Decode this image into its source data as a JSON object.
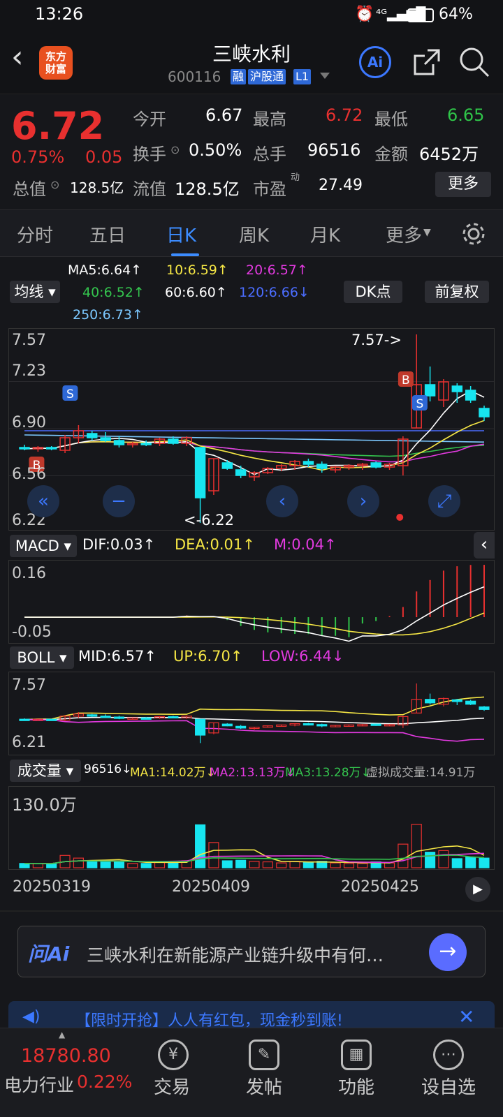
{
  "status": {
    "time": "13:26",
    "battery": "64%"
  },
  "header": {
    "title": "三峡水利",
    "code": "600116",
    "tags": [
      "融",
      "沪股通",
      "L1"
    ],
    "logo": "东方\n财富",
    "ai_label": "Ai"
  },
  "quote": {
    "price": "6.72",
    "change_pct": "0.75%",
    "change": "0.05",
    "open_label": "今开",
    "open": "6.67",
    "high_label": "最高",
    "high": "6.72",
    "low_label": "最低",
    "low": "6.65",
    "turnover_label": "换手",
    "turnover": "0.50%",
    "volume_label": "总手",
    "volume": "96516",
    "amount_label": "金额",
    "amount": "6452万",
    "mktcap_label": "总值",
    "mktcap": "128.5亿",
    "float_label": "流值",
    "float": "128.5亿",
    "pe_label": "市盈",
    "pe_sup": "动",
    "pe": "27.49",
    "more": "更多"
  },
  "tabs": [
    "分时",
    "五日",
    "日K",
    "周K",
    "月K",
    "更多"
  ],
  "ma": {
    "ma5": "MA5:6.64↑",
    "ma10": "10:6.59↑",
    "ma20": "20:6.57↑",
    "ma40": "40:6.52↑",
    "ma60": "60:6.60↑",
    "ma120": "120:6.66↓",
    "ma250": "250:6.73↑",
    "junxian": "均线",
    "dk": "DK点",
    "fuquan": "前复权"
  },
  "kline": {
    "y_top": "7.57",
    "y2": "7.23",
    "y3": "6.90",
    "y4": "6.56",
    "y_bot": "6.22",
    "max_note": "7.57",
    "min_note": "6.22",
    "marker_b": "B",
    "marker_s": "S"
  },
  "macd": {
    "label": "MACD",
    "dif": "DIF:0.03↑",
    "dea": "DEA:0.01↑",
    "m": "M:0.04↑",
    "y_top": "0.16",
    "y_bot": "-0.05"
  },
  "boll": {
    "label": "BOLL",
    "mid": "MID:6.57↑",
    "up": "UP:6.70↑",
    "low": "LOW:6.44↓",
    "y_top": "7.57",
    "y_bot": "6.21"
  },
  "vol": {
    "label": "成交量",
    "v": "96516↓",
    "ma1": "MA1:14.02万↓",
    "ma2": "MA2:13.13万↓",
    "ma3": "MA3:13.28万↓",
    "virtual": "虚拟成交量:14.91万",
    "y_top": "130.0万"
  },
  "dates": [
    "20250319",
    "20250409",
    "20250425"
  ],
  "ask": {
    "brand": "问Ai",
    "text": "三峡水利在新能源产业链升级中有何…"
  },
  "banner": {
    "text": "【限时开抢】人人有红包，现金秒到账!"
  },
  "bottom": {
    "index_value": "18780.80",
    "index_name": "电力行业",
    "index_pct": "0.22%",
    "nav": [
      "交易",
      "发帖",
      "功能",
      "设自选"
    ]
  },
  "colors": {
    "up": "#e8302f",
    "down": "#17e5f0",
    "accent": "#3c8cff"
  },
  "chart_data": {
    "type": "candlestick",
    "ohlc": [
      [
        6.76,
        6.78,
        6.74,
        6.75
      ],
      [
        6.75,
        6.77,
        6.73,
        6.76
      ],
      [
        6.76,
        6.77,
        6.74,
        6.75
      ],
      [
        6.74,
        6.85,
        6.72,
        6.83
      ],
      [
        6.83,
        6.92,
        6.79,
        6.88
      ],
      [
        6.86,
        6.88,
        6.81,
        6.83
      ],
      [
        6.83,
        6.87,
        6.8,
        6.81
      ],
      [
        6.81,
        6.84,
        6.76,
        6.78
      ],
      [
        6.78,
        6.8,
        6.76,
        6.79
      ],
      [
        6.79,
        6.81,
        6.77,
        6.78
      ],
      [
        6.79,
        6.83,
        6.77,
        6.82
      ],
      [
        6.82,
        6.84,
        6.78,
        6.79
      ],
      [
        6.79,
        6.84,
        6.77,
        6.83
      ],
      [
        6.76,
        6.76,
        6.22,
        6.4
      ],
      [
        6.45,
        6.68,
        6.42,
        6.68
      ],
      [
        6.65,
        6.67,
        6.6,
        6.61
      ],
      [
        6.6,
        6.63,
        6.54,
        6.56
      ],
      [
        6.55,
        6.59,
        6.52,
        6.58
      ],
      [
        6.58,
        6.62,
        6.57,
        6.61
      ],
      [
        6.61,
        6.64,
        6.59,
        6.63
      ],
      [
        6.63,
        6.67,
        6.6,
        6.66
      ],
      [
        6.66,
        6.68,
        6.62,
        6.64
      ],
      [
        6.64,
        6.66,
        6.58,
        6.61
      ],
      [
        6.6,
        6.63,
        6.58,
        6.62
      ],
      [
        6.62,
        6.64,
        6.6,
        6.63
      ],
      [
        6.63,
        6.65,
        6.6,
        6.64
      ],
      [
        6.65,
        6.66,
        6.61,
        6.62
      ],
      [
        6.62,
        6.65,
        6.6,
        6.64
      ],
      [
        6.63,
        6.84,
        6.56,
        6.82
      ],
      [
        6.9,
        7.57,
        6.9,
        7.21
      ],
      [
        7.21,
        7.34,
        7.09,
        7.13
      ],
      [
        7.1,
        7.25,
        7.05,
        7.23
      ],
      [
        7.2,
        7.22,
        7.08,
        7.16
      ],
      [
        7.17,
        7.2,
        7.08,
        7.1
      ],
      [
        7.04,
        7.06,
        6.95,
        6.98
      ]
    ]
  }
}
